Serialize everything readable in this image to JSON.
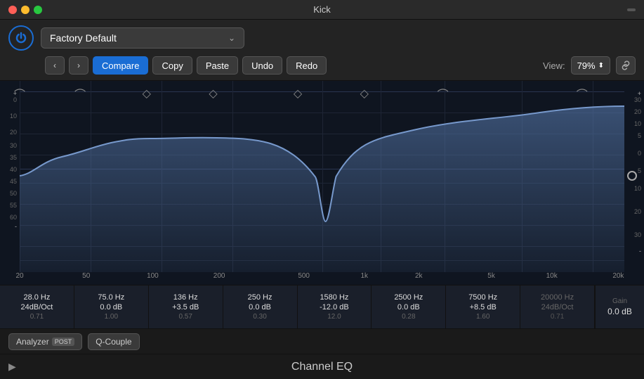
{
  "window": {
    "title": "Kick"
  },
  "header": {
    "preset_label": "Factory Default",
    "nav_prev": "‹",
    "nav_next": "›",
    "compare_label": "Compare",
    "copy_label": "Copy",
    "paste_label": "Paste",
    "undo_label": "Undo",
    "redo_label": "Redo",
    "view_label": "View:",
    "view_pct": "79%",
    "link_icon": "⚭"
  },
  "bands": [
    {
      "freq": "28.0 Hz",
      "db": "24dB/Oct",
      "q": "0.71",
      "type": "HP"
    },
    {
      "freq": "75.0 Hz",
      "db": "0.0 dB",
      "q": "1.00",
      "type": "Bell"
    },
    {
      "freq": "136 Hz",
      "db": "+3.5 dB",
      "q": "0.57",
      "type": "Bell"
    },
    {
      "freq": "250 Hz",
      "db": "0.0 dB",
      "q": "0.30",
      "type": "Bell"
    },
    {
      "freq": "1580 Hz",
      "db": "-12.0 dB",
      "q": "12.0",
      "type": "Bell"
    },
    {
      "freq": "2500 Hz",
      "db": "0.0 dB",
      "q": "0.28",
      "type": "Bell"
    },
    {
      "freq": "7500 Hz",
      "db": "+8.5 dB",
      "q": "1.60",
      "type": "Bell"
    },
    {
      "freq": "20000 Hz",
      "db": "24dB/Oct",
      "q": "0.71",
      "type": "LP"
    }
  ],
  "gain": {
    "label": "Gain",
    "value": "0.0 dB"
  },
  "db_labels_left": [
    "+",
    "0",
    "10",
    "20",
    "30",
    "35",
    "40",
    "45",
    "50",
    "55",
    "60",
    "-"
  ],
  "db_labels_right": [
    "+",
    "30",
    "20",
    "10",
    "5",
    "0",
    "5",
    "10",
    "20",
    "30",
    "-"
  ],
  "freq_labels": [
    "20",
    "50",
    "100",
    "200",
    "500",
    "1k",
    "2k",
    "5k",
    "10k",
    "20k"
  ],
  "bottom": {
    "analyzer_label": "Analyzer",
    "post_label": "POST",
    "q_couple_label": "Q-Couple"
  },
  "footer": {
    "title": "Channel EQ",
    "play_icon": "▶"
  }
}
